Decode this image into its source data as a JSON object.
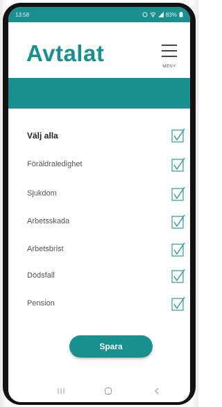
{
  "status_bar": {
    "time": "13:58",
    "battery": "83%"
  },
  "header": {
    "logo_text": "Avtalat",
    "menu_label": "MENY"
  },
  "list": {
    "items": [
      {
        "label": "Välj alla",
        "checked": true
      },
      {
        "label": "Föräldraledighet",
        "checked": true
      },
      {
        "label": "Sjukdom",
        "checked": true
      },
      {
        "label": "Arbetsskada",
        "checked": true
      },
      {
        "label": "Arbetsbrist",
        "checked": true
      },
      {
        "label": "Dödsfall",
        "checked": true
      },
      {
        "label": "Pension",
        "checked": true
      }
    ]
  },
  "actions": {
    "save_label": "Spara"
  },
  "colors": {
    "brand": "#1a8f8f",
    "checkbox": "#2a9a9a"
  },
  "nav": {
    "recents_icon": "recents-icon",
    "home_icon": "home-icon",
    "back_icon": "back-icon"
  }
}
